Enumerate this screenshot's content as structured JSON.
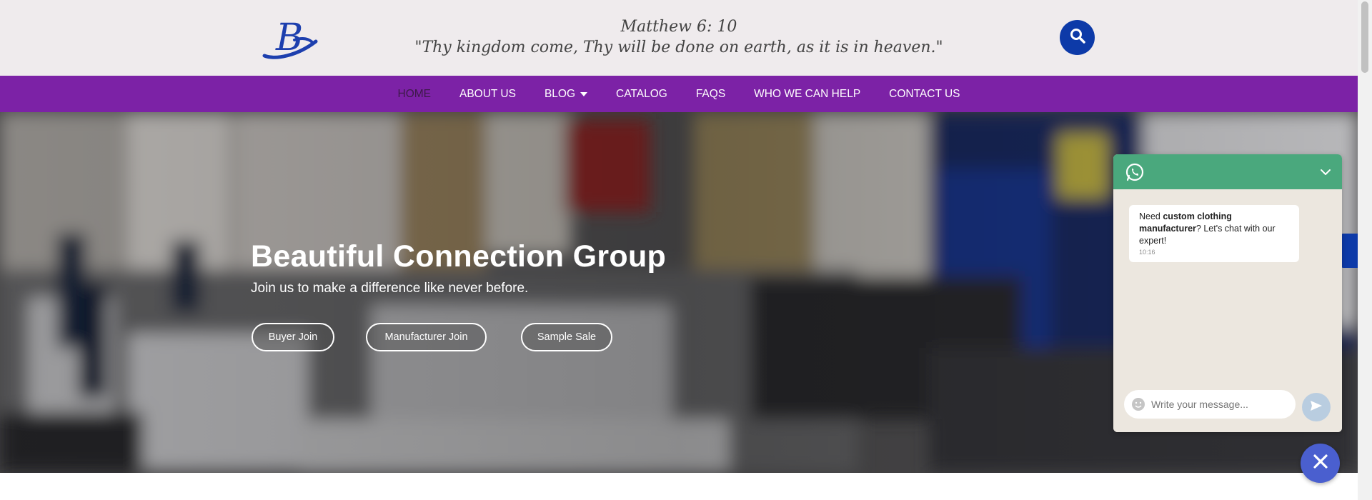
{
  "header": {
    "logo_icon": "b-logo-icon",
    "verse_reference": "Matthew 6: 10",
    "verse_text": "\"Thy kingdom come, Thy will be done on earth, as it is in heaven.\"",
    "search_icon": "search-icon",
    "brand_color": "#0d3aa8"
  },
  "nav": {
    "background": "#7c22a6",
    "items": [
      {
        "label": "HOME"
      },
      {
        "label": "ABOUT US"
      },
      {
        "label": "BLOG"
      },
      {
        "label": "CATALOG"
      },
      {
        "label": "FAQS"
      },
      {
        "label": "WHO WE CAN HELP"
      },
      {
        "label": "CONTACT US"
      }
    ]
  },
  "hero": {
    "title": "Beautiful Connection Group",
    "subtitle": "Join us to make a difference like never before.",
    "buttons": [
      {
        "label": "Buyer Join"
      },
      {
        "label": "Manufacturer Join"
      },
      {
        "label": "Sample Sale"
      }
    ]
  },
  "chat": {
    "header_color": "#4aa87d",
    "message_prefix": "Need ",
    "message_bold": "custom clothing manufacturer",
    "message_suffix": "? Let's chat with our expert!",
    "message_time": "10:16",
    "input_placeholder": "Write your message...",
    "icons": [
      "whatsapp-icon",
      "chevron-down-icon",
      "smile-icon",
      "send-icon",
      "close-icon"
    ]
  }
}
